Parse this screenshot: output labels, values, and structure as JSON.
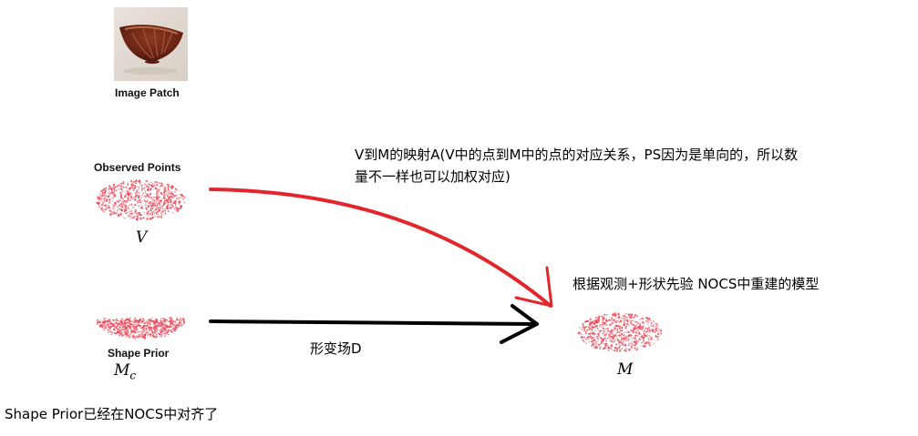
{
  "image_patch": {
    "caption": "Image Patch"
  },
  "observed": {
    "caption": "Observed Points",
    "symbol": "V"
  },
  "prior": {
    "caption": "Shape Prior",
    "symbol": "M",
    "subscript": "c"
  },
  "result": {
    "symbol": "M"
  },
  "annotations": {
    "mapping_line1": "V到M的映射A(V中的点到M中的点的对应关系，PS因为是单向的，所以数",
    "mapping_line2": "量不一样也可以加权对应)",
    "reconstruction": "根据观测+形状先验 NOCS中重建的模型",
    "deformation": "形变场D",
    "prior_aligned": "Shape Prior已经在NOCS中对齐了"
  },
  "colors": {
    "mapping_arrow": "#e2262c",
    "deformation_arrow": "#000000",
    "points": "#e84a5a"
  }
}
